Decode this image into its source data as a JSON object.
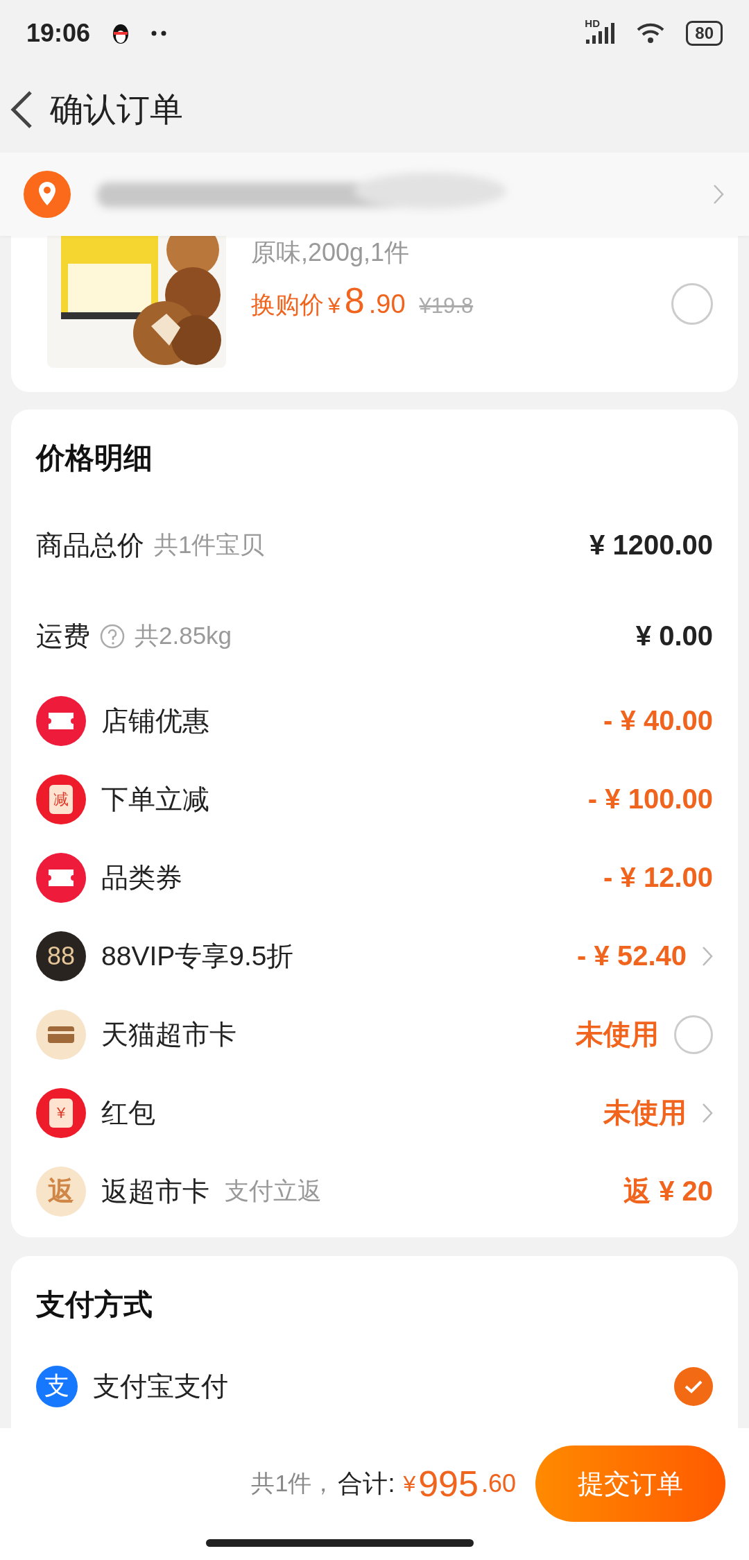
{
  "status_bar": {
    "time": "19:06",
    "network": "HD",
    "battery": "80"
  },
  "header": {
    "title": "确认订单"
  },
  "product": {
    "spec": "原味,200g,1件",
    "price_label": "换购价",
    "currency": "¥",
    "price_int": "8",
    "price_dec": ".90",
    "original_price": "¥19.8",
    "checked": false
  },
  "price_detail": {
    "title": "价格明细",
    "rows": [
      {
        "kind": "plain",
        "label": "商品总价",
        "note": "共1件宝贝",
        "amount": "¥ 1200.00"
      },
      {
        "kind": "plain",
        "label": "运费",
        "help": true,
        "note": "共2.85kg",
        "amount": "¥ 0.00"
      },
      {
        "kind": "coupon",
        "label": "店铺优惠",
        "amount": "- ¥ 40.00"
      },
      {
        "kind": "instant",
        "icon_text": "减",
        "label": "下单立减",
        "amount": "- ¥ 100.00"
      },
      {
        "kind": "coupon",
        "label": "品类券",
        "amount": "- ¥ 12.00"
      },
      {
        "kind": "vip",
        "icon_text": "88",
        "label": "88VIP专享9.5折",
        "amount": "- ¥ 52.40"
      },
      {
        "kind": "giftcard",
        "label": "天猫超市卡",
        "amount": "未使用",
        "checked": false
      },
      {
        "kind": "envelope",
        "icon_text": "¥",
        "label": "红包",
        "amount": "未使用"
      },
      {
        "kind": "cashback",
        "icon_text": "返",
        "label": "返超市卡",
        "note": "支付立返",
        "amount": "返 ¥ 20"
      }
    ]
  },
  "payment": {
    "title": "支付方式",
    "methods": [
      {
        "label": "支付宝支付",
        "icon_text": "支",
        "selected": true
      }
    ]
  },
  "footer": {
    "count": "共1件，",
    "total_label": "合计:",
    "currency": "¥",
    "total_int": "995",
    "total_dec": ".60",
    "submit": "提交订单"
  }
}
